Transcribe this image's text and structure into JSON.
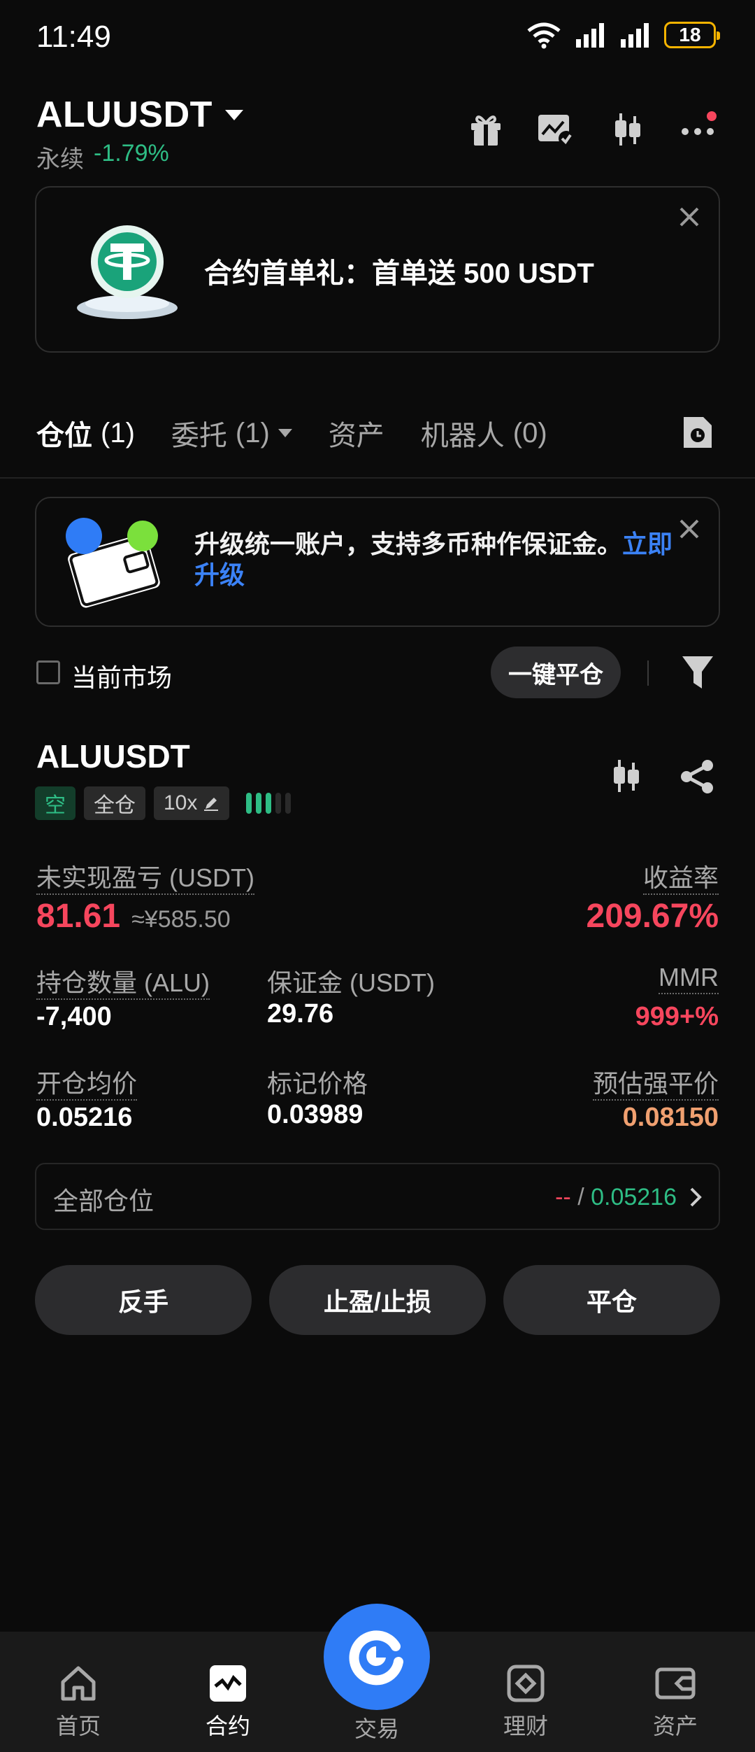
{
  "status_bar": {
    "time": "11:49",
    "battery": "18"
  },
  "header": {
    "pair": "ALUUSDT",
    "contract_type": "永续",
    "change": "-1.79%"
  },
  "promo": {
    "text": "合约首单礼：首单送 500 USDT"
  },
  "tabs": [
    {
      "label": "仓位",
      "count": "(1)"
    },
    {
      "label": "委托",
      "count": "(1)"
    },
    {
      "label": "资产",
      "count": ""
    },
    {
      "label": "机器人",
      "count": "(0)"
    }
  ],
  "upgrade": {
    "text": "升级统一账户，支持多币种作保证金。",
    "link": "立即升级"
  },
  "filter": {
    "current_market": "当前市场",
    "close_all": "一键平仓"
  },
  "position": {
    "symbol": "ALUUSDT",
    "side": "空",
    "margin_mode": "全仓",
    "leverage": "10x",
    "risk_level": 3,
    "unrealized_pnl_label": "未实现盈亏 (USDT)",
    "unrealized_pnl": "81.61",
    "unrealized_pnl_cny": "≈¥585.50",
    "roe_label": "收益率",
    "roe": "209.67%",
    "size_label": "持仓数量 (ALU)",
    "size": "-7,400",
    "margin_label": "保证金 (USDT)",
    "margin": "29.76",
    "mmr_label": "MMR",
    "mmr": "999+%",
    "entry_label": "开仓均价",
    "entry": "0.05216",
    "mark_label": "标记价格",
    "mark": "0.03989",
    "liq_label": "预估强平价",
    "liq": "0.08150",
    "all_positions_label": "全部仓位",
    "all_positions_dash": "--",
    "all_positions_sep": " / ",
    "all_positions_value": "0.05216"
  },
  "actions": {
    "reverse": "反手",
    "tpsl": "止盈/止损",
    "close": "平仓"
  },
  "nav": [
    {
      "label": "首页",
      "icon": "home-icon"
    },
    {
      "label": "合约",
      "icon": "futures-icon"
    },
    {
      "label": "交易",
      "icon": "trade-logo-icon"
    },
    {
      "label": "理财",
      "icon": "earn-icon"
    },
    {
      "label": "资产",
      "icon": "wallet-icon"
    }
  ],
  "colors": {
    "green": "#2ebd85",
    "red": "#f6465d",
    "blue": "#2f7cf6",
    "orange": "#f0a070"
  }
}
